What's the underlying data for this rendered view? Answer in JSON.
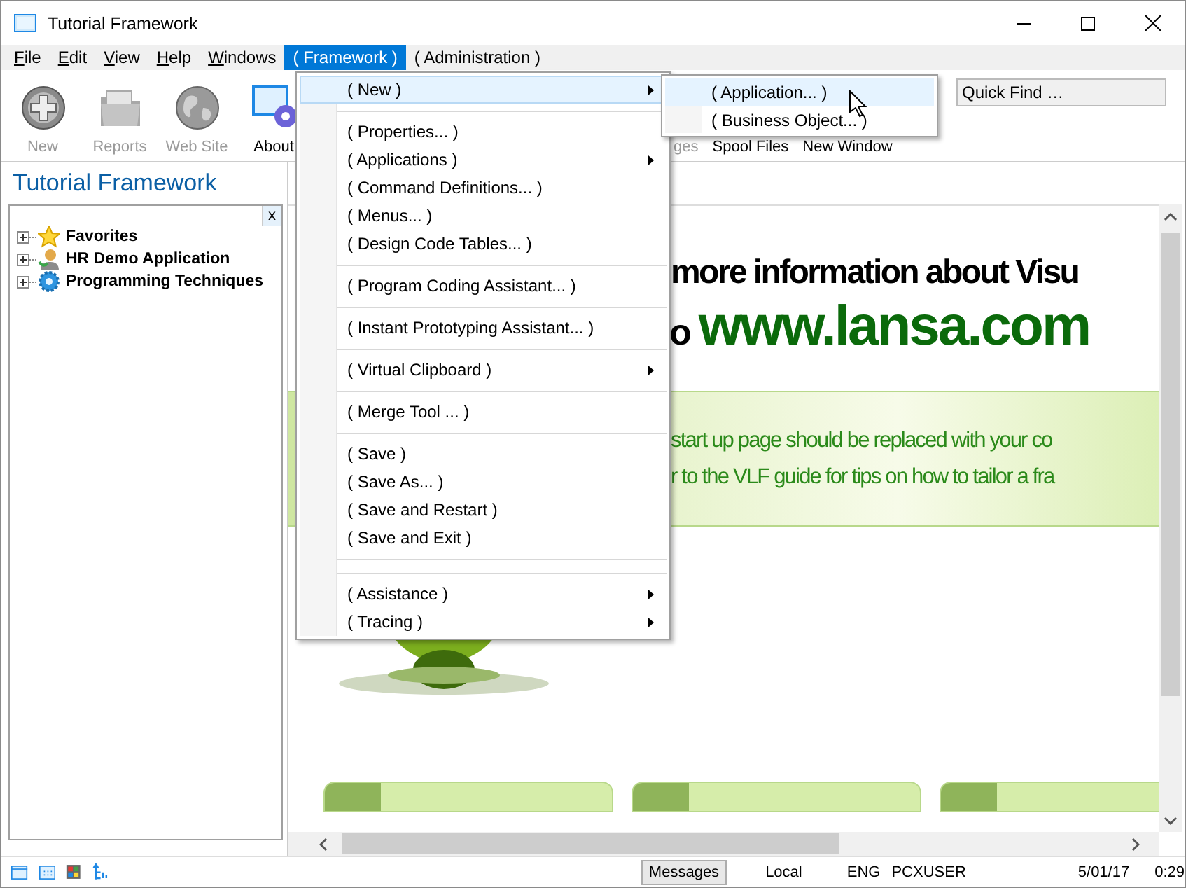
{
  "window": {
    "title": "Tutorial Framework"
  },
  "menubar": [
    {
      "label": "File",
      "mnemonic": true,
      "selected": false
    },
    {
      "label": "Edit",
      "mnemonic": true,
      "selected": false
    },
    {
      "label": "View",
      "mnemonic": true,
      "selected": false
    },
    {
      "label": "Help",
      "mnemonic": true,
      "selected": false
    },
    {
      "label": "Windows",
      "mnemonic": true,
      "selected": false
    },
    {
      "label": "( Framework )",
      "mnemonic": false,
      "selected": true
    },
    {
      "label": "( Administration )",
      "mnemonic": false,
      "selected": false
    }
  ],
  "toolbar": [
    {
      "kind": "icon",
      "label": "New",
      "disabled": true
    },
    {
      "kind": "icon",
      "label": "Reports",
      "disabled": true
    },
    {
      "kind": "icon",
      "label": "Web Site",
      "disabled": true
    },
    {
      "kind": "icon",
      "label": "About",
      "disabled": false
    },
    {
      "kind": "text",
      "label": "ges",
      "disabled": true
    },
    {
      "kind": "text",
      "label": "Spool Files",
      "disabled": false
    },
    {
      "kind": "text",
      "label": "New Window",
      "disabled": false
    }
  ],
  "quick_find": {
    "placeholder": "Quick Find …"
  },
  "navigator": {
    "title": "Tutorial Framework",
    "close": "x",
    "tree": [
      {
        "label": "Favorites",
        "expanded": false
      },
      {
        "label": "HR Demo Application",
        "expanded": false
      },
      {
        "label": "Programming Techniques",
        "expanded": false
      }
    ]
  },
  "content": {
    "headline": "more information about Visu",
    "url_prefix": "o",
    "url": "www.lansa.com",
    "banner": [
      "start up page should be replaced with your co",
      "r to the VLF guide for tips on how to tailor a fra"
    ]
  },
  "framework_menu": [
    {
      "kind": "item",
      "label": "( New )",
      "submenu": true,
      "selected": true
    },
    {
      "kind": "separator"
    },
    {
      "kind": "item",
      "label": "( Properties... )",
      "submenu": false,
      "selected": false
    },
    {
      "kind": "item",
      "label": "( Applications )",
      "submenu": true,
      "selected": false
    },
    {
      "kind": "item",
      "label": "( Command Definitions... )",
      "submenu": false,
      "selected": false
    },
    {
      "kind": "item",
      "label": "( Menus... )",
      "submenu": false,
      "selected": false
    },
    {
      "kind": "item",
      "label": "( Design Code Tables... )",
      "submenu": false,
      "selected": false
    },
    {
      "kind": "separator"
    },
    {
      "kind": "item",
      "label": "( Program Coding Assistant... )",
      "submenu": false,
      "selected": false
    },
    {
      "kind": "separator"
    },
    {
      "kind": "item",
      "label": "( Instant Prototyping Assistant... )",
      "submenu": false,
      "selected": false
    },
    {
      "kind": "separator"
    },
    {
      "kind": "item",
      "label": "( Virtual Clipboard )",
      "submenu": true,
      "selected": false
    },
    {
      "kind": "separator"
    },
    {
      "kind": "item",
      "label": "( Merge Tool ... )",
      "submenu": false,
      "selected": false
    },
    {
      "kind": "separator"
    },
    {
      "kind": "item",
      "label": "( Save )",
      "submenu": false,
      "selected": false
    },
    {
      "kind": "item",
      "label": "( Save As... )",
      "submenu": false,
      "selected": false
    },
    {
      "kind": "item",
      "label": "( Save and Restart )",
      "submenu": false,
      "selected": false
    },
    {
      "kind": "item",
      "label": "( Save and Exit )",
      "submenu": false,
      "selected": false
    },
    {
      "kind": "separator"
    },
    {
      "kind": "separator"
    },
    {
      "kind": "item",
      "label": "( Assistance )",
      "submenu": true,
      "selected": false
    },
    {
      "kind": "item",
      "label": "( Tracing )",
      "submenu": true,
      "selected": false
    }
  ],
  "new_submenu": [
    {
      "label": "( Application... )",
      "selected": true
    },
    {
      "label": "( Business Object... )",
      "selected": false
    }
  ],
  "status_bar": {
    "messages": "Messages",
    "location": "Local",
    "language": "ENG",
    "user": "PCXUSER",
    "date": "5/01/17",
    "time": "0:29"
  }
}
